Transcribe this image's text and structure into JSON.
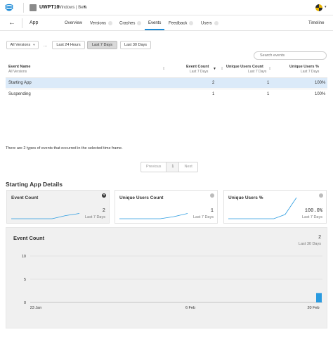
{
  "topbar": {
    "app_name": "UWPT10",
    "app_os": "Windows | Beta",
    "logo_icon": "visual-studio-app-center-logo",
    "avatar_icon": "user-avatar"
  },
  "nav": {
    "back_icon": "back-arrow-icon",
    "app_label": "App",
    "tabs": [
      {
        "label": "Overview",
        "badge": false
      },
      {
        "label": "Versions",
        "badge": true
      },
      {
        "label": "Crashes",
        "badge": true
      },
      {
        "label": "Events",
        "badge": false,
        "active": true
      },
      {
        "label": "Feedback",
        "badge": true
      },
      {
        "label": "Users",
        "badge": true
      }
    ],
    "timeline_label": "Timeline",
    "accent": "#1c8ad6"
  },
  "filters": {
    "versions_dropdown": "All Versions",
    "ellipsis": "...",
    "ranges": [
      "Last 24 Hours",
      "Last 7 Days",
      "Last 30 Days"
    ],
    "selected_range": "Last 7 Days",
    "search_placeholder": "Search events"
  },
  "table": {
    "headers": {
      "event_name": "Event Name",
      "event_name_sub": "All Versions",
      "event_count": "Event Count",
      "event_count_sub": "Last 7 Days",
      "unique_users_count": "Unique Users Count",
      "unique_users_count_sub": "Last 7 Days",
      "unique_users_pct": "Unique Users %",
      "unique_users_pct_sub": "Last 7 Days"
    },
    "sort_arrow": "▼",
    "rows": [
      {
        "name": "Starting App",
        "count": "2",
        "users": "1",
        "pct": "100%",
        "selected": true
      },
      {
        "name": "Suspending",
        "count": "1",
        "users": "1",
        "pct": "100%",
        "selected": false
      }
    ]
  },
  "summary_text": "There are 2 types of events that occurred in the selected time frame.",
  "pagination": {
    "previous": "Previous",
    "page": "1",
    "next": "Next"
  },
  "details": {
    "title": "Starting App Details",
    "cards": [
      {
        "title": "Event Count",
        "value": "2",
        "sub": "Last 7 Days",
        "active": true,
        "trend": [
          0,
          0,
          0,
          0,
          0.15,
          0.25
        ],
        "info": "?"
      },
      {
        "title": "Unique Users Count",
        "value": "1",
        "sub": "Last 7 Days",
        "active": false,
        "trend": [
          0,
          0,
          0,
          0,
          0.1,
          0.25
        ],
        "info": ""
      },
      {
        "title": "Unique Users %",
        "value": "100.0%",
        "sub": "Last 7 Days",
        "active": false,
        "trend": [
          0,
          0,
          0,
          0,
          0,
          0.2,
          1.0
        ],
        "info": ""
      }
    ]
  },
  "chart_panel": {
    "title": "Event Count",
    "value": "2",
    "sub": "Last 30 Days",
    "bar_color": "#2a9be0"
  },
  "chart_data": {
    "type": "bar",
    "title": "Event Count",
    "xlabel": "",
    "ylabel": "",
    "ylim": [
      0,
      10
    ],
    "yticks": [
      0,
      5,
      10
    ],
    "x_tick_labels": [
      "23 Jan",
      "6 Feb",
      "20 Feb"
    ],
    "x_range": [
      "2017-01-23",
      "2017-02-21"
    ],
    "series": [
      {
        "x": [
          "2017-02-21"
        ],
        "values": [
          2
        ]
      }
    ]
  }
}
